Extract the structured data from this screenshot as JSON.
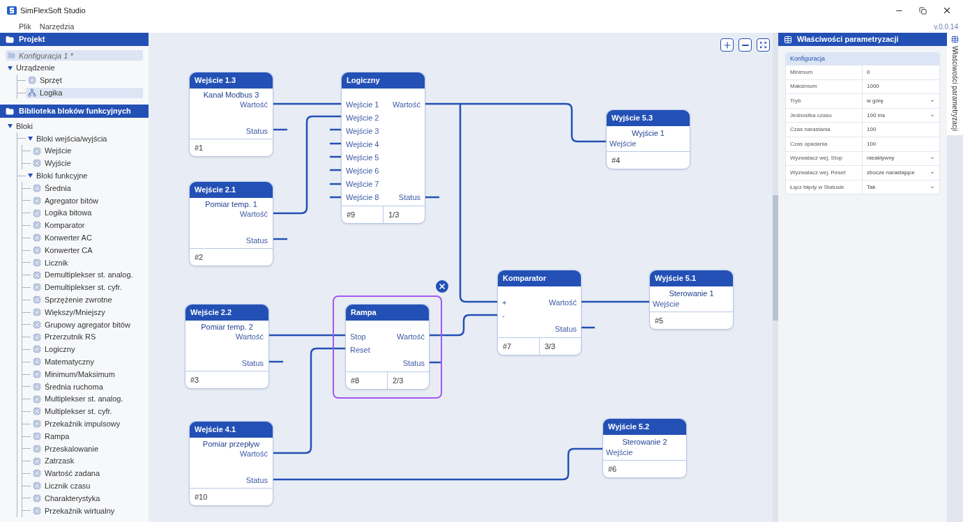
{
  "window": {
    "title": "SimFlexSoft Studio"
  },
  "menu": [
    "Plik",
    "Narzędzia"
  ],
  "version": "v.0.0.14",
  "project": {
    "title": "Projekt",
    "items": [
      {
        "label": "Konfiguracja 1 *",
        "kind": "root",
        "selected": true
      },
      {
        "label": "Urządzenie",
        "kind": "group",
        "expanded": true,
        "selected": false,
        "children": [
          {
            "label": "Sprzęt",
            "kind": "chip",
            "selected": false
          },
          {
            "label": "Logika",
            "kind": "network",
            "selected": true
          }
        ]
      }
    ]
  },
  "library": {
    "title": "Biblioteka bloków funkcyjnych",
    "items": [
      {
        "label": "Bloki",
        "kind": "group",
        "expanded": true,
        "children": [
          {
            "label": "Bloki wejścia/wyjścia",
            "kind": "group",
            "expanded": true,
            "children": [
              {
                "label": "Wejście",
                "kind": "chip"
              },
              {
                "label": "Wyjście",
                "kind": "chip"
              }
            ]
          },
          {
            "label": "Bloki funkcyjne",
            "kind": "group",
            "expanded": true,
            "children": [
              {
                "label": "Średnia",
                "kind": "chip"
              },
              {
                "label": "Agregator bitów",
                "kind": "chip"
              },
              {
                "label": "Logika bitowa",
                "kind": "chip"
              },
              {
                "label": "Komparator",
                "kind": "chip"
              },
              {
                "label": "Konwerter AC",
                "kind": "chip"
              },
              {
                "label": "Konwerter CA",
                "kind": "chip"
              },
              {
                "label": "Licznik",
                "kind": "chip"
              },
              {
                "label": "Demultiplekser st. analog.",
                "kind": "chip"
              },
              {
                "label": "Demultiplekser st. cyfr.",
                "kind": "chip"
              },
              {
                "label": "Sprzężenie zwrotne",
                "kind": "chip"
              },
              {
                "label": "Większy/Mniejszy",
                "kind": "chip"
              },
              {
                "label": "Grupowy agregator bitów",
                "kind": "chip"
              },
              {
                "label": "Przerzutnik RS",
                "kind": "chip"
              },
              {
                "label": "Logiczny",
                "kind": "chip"
              },
              {
                "label": "Matematyczny",
                "kind": "chip"
              },
              {
                "label": "Minimum/Maksimum",
                "kind": "chip"
              },
              {
                "label": "Średnia ruchoma",
                "kind": "chip"
              },
              {
                "label": "Multiplekser st. analog.",
                "kind": "chip"
              },
              {
                "label": "Multiplekser st. cyfr.",
                "kind": "chip"
              },
              {
                "label": "Przekaźnik impulsowy",
                "kind": "chip"
              },
              {
                "label": "Rampa",
                "kind": "chip"
              },
              {
                "label": "Przeskalowanie",
                "kind": "chip"
              },
              {
                "label": "Zatrzask",
                "kind": "chip"
              },
              {
                "label": "Wartość zadana",
                "kind": "chip"
              },
              {
                "label": "Licznik czasu",
                "kind": "chip"
              },
              {
                "label": "Charakterystyka",
                "kind": "chip"
              },
              {
                "label": "Przekaźnik wirtualny",
                "kind": "chip"
              }
            ]
          }
        ]
      }
    ]
  },
  "nodes": [
    {
      "kind": "input",
      "title": "Wejście 1.3",
      "subtitle": "Kanał Modbus 3",
      "outputs": [
        "Wartość",
        "Status"
      ],
      "footer": [
        "#1"
      ],
      "selected": false
    },
    {
      "kind": "block",
      "title": "Logiczny",
      "inputs": [
        "Wejście 1",
        "Wejście 2",
        "Wejście 3",
        "Wejście 4",
        "Wejście 5",
        "Wejście 6",
        "Wejście 7",
        "Wejście 8"
      ],
      "outputs": [
        "Wartość",
        "Status"
      ],
      "footer": [
        "#9",
        "1/3"
      ],
      "selected": false
    },
    {
      "kind": "output",
      "title": "Wyjście 5.3",
      "subtitle": "Wyjście 1",
      "inputs": [
        "Wejście"
      ],
      "footer": [
        "#4"
      ],
      "selected": false
    },
    {
      "kind": "input",
      "title": "Wejście 2.1",
      "subtitle": "Pomiar temp. 1",
      "outputs": [
        "Wartość",
        "Status"
      ],
      "footer": [
        "#2"
      ],
      "selected": false
    },
    {
      "kind": "block",
      "title": "Komparator",
      "inputs": [
        "+",
        "-"
      ],
      "outputs": [
        "Wartość",
        "Status"
      ],
      "footer": [
        "#7",
        "3/3"
      ],
      "selected": false
    },
    {
      "kind": "output",
      "title": "Wyjście 5.1",
      "subtitle": "Sterowanie 1",
      "inputs": [
        "Wejście"
      ],
      "footer": [
        "#5"
      ],
      "selected": false
    },
    {
      "kind": "input",
      "title": "Wejście 2.2",
      "subtitle": "Pomiar temp. 2",
      "outputs": [
        "Wartość",
        "Status"
      ],
      "footer": [
        "#3"
      ],
      "selected": false
    },
    {
      "kind": "block",
      "title": "Rampa",
      "inputs": [
        "Stop",
        "Reset"
      ],
      "outputs": [
        "Wartość",
        "Status"
      ],
      "footer": [
        "#8",
        "2/3"
      ],
      "selected": true
    },
    {
      "kind": "input",
      "title": "Wejście 4.1",
      "subtitle": "Pomiar przepływ",
      "outputs": [
        "Wartość",
        "Status"
      ],
      "footer": [
        "#10"
      ],
      "selected": false
    },
    {
      "kind": "output",
      "title": "Wyjście 5.2",
      "subtitle": "Sterowanie 2",
      "inputs": [
        "Wejście"
      ],
      "footer": [
        "#6"
      ],
      "selected": false
    }
  ],
  "properties": {
    "title": "Właściwości parametryzacji",
    "section": "Konfiguracja",
    "rows": [
      {
        "label": "Minimum",
        "value": "0",
        "kind": "text"
      },
      {
        "label": "Maksimum",
        "value": "1000",
        "kind": "text"
      },
      {
        "label": "Tryb",
        "value": "w górę",
        "kind": "select"
      },
      {
        "label": "Jednostka czasu",
        "value": "100 ms",
        "kind": "select"
      },
      {
        "label": "Czas narastania",
        "value": "100",
        "kind": "text"
      },
      {
        "label": "Czas opadania",
        "value": "100",
        "kind": "text"
      },
      {
        "label": "Wyzwalacz wej. Stop",
        "value": "nieaktywny",
        "kind": "select"
      },
      {
        "label": "Wyzwalacz wej. Reset",
        "value": "zbocze narastające",
        "kind": "select"
      },
      {
        "label": "Łącz błędy w Statusie",
        "value": "Tak",
        "kind": "select"
      }
    ]
  },
  "side_tab": {
    "label": "Właściwości parametryzacji"
  }
}
